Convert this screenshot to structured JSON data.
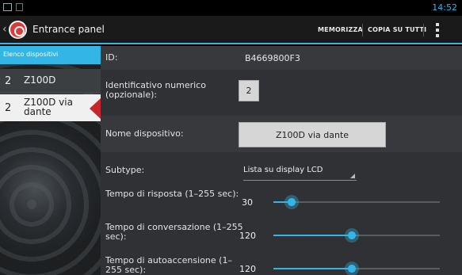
{
  "status_bar": {
    "time": "14:52"
  },
  "action_bar": {
    "title": "Entrance panel",
    "save_label": "MEMORIZZA",
    "copy_all_label": "COPIA SU TUTTI"
  },
  "sidebar": {
    "header": "Elenco dispositivi",
    "devices": [
      {
        "number": "2",
        "name": "Z100D",
        "selected": false
      },
      {
        "number": "2",
        "name": "Z100D via dante",
        "selected": true
      }
    ]
  },
  "form": {
    "id_label": "ID:",
    "id_value": "B4669800F3",
    "numeric_id_label": "Identificativo numerico (opzionale):",
    "numeric_id_value": "2",
    "device_name_label": "Nome dispositivo:",
    "device_name_value": "Z100D via dante",
    "subtype_label": "Subtype:",
    "subtype_value": "Lista su display LCD",
    "sliders": [
      {
        "label": "Tempo di risposta (1–255 sec):",
        "value": "30",
        "fraction": 0.11
      },
      {
        "label": "Tempo di conversazione (1–255 sec):",
        "value": "120",
        "fraction": 0.47
      },
      {
        "label": "Tempo di autoaccensione (1–255 sec):",
        "value": "120",
        "fraction": 0.47
      }
    ]
  },
  "colors": {
    "accent": "#33b5e5",
    "selection_marker": "#c8252d"
  }
}
